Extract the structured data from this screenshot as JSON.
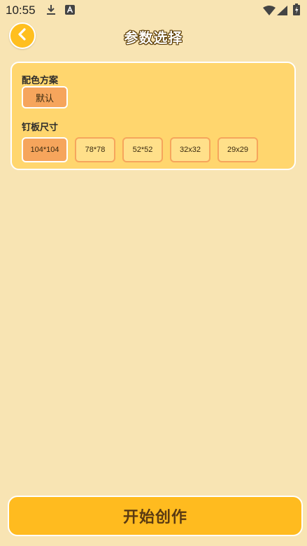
{
  "status_bar": {
    "time": "10:55"
  },
  "header": {
    "title": "参数选择"
  },
  "color_scheme": {
    "label": "配色方案",
    "options": [
      "默认"
    ],
    "selected": "默认"
  },
  "board_size": {
    "label": "钉板尺寸",
    "options": [
      "104*104",
      "78*78",
      "52*52",
      "32x32",
      "29x29"
    ],
    "selected": "104*104"
  },
  "footer": {
    "start_label": "开始创作"
  },
  "colors": {
    "background": "#f8e4b3",
    "panel": "#ffd66e",
    "accent": "#ffbb1f",
    "selected": "#f6a55c"
  }
}
